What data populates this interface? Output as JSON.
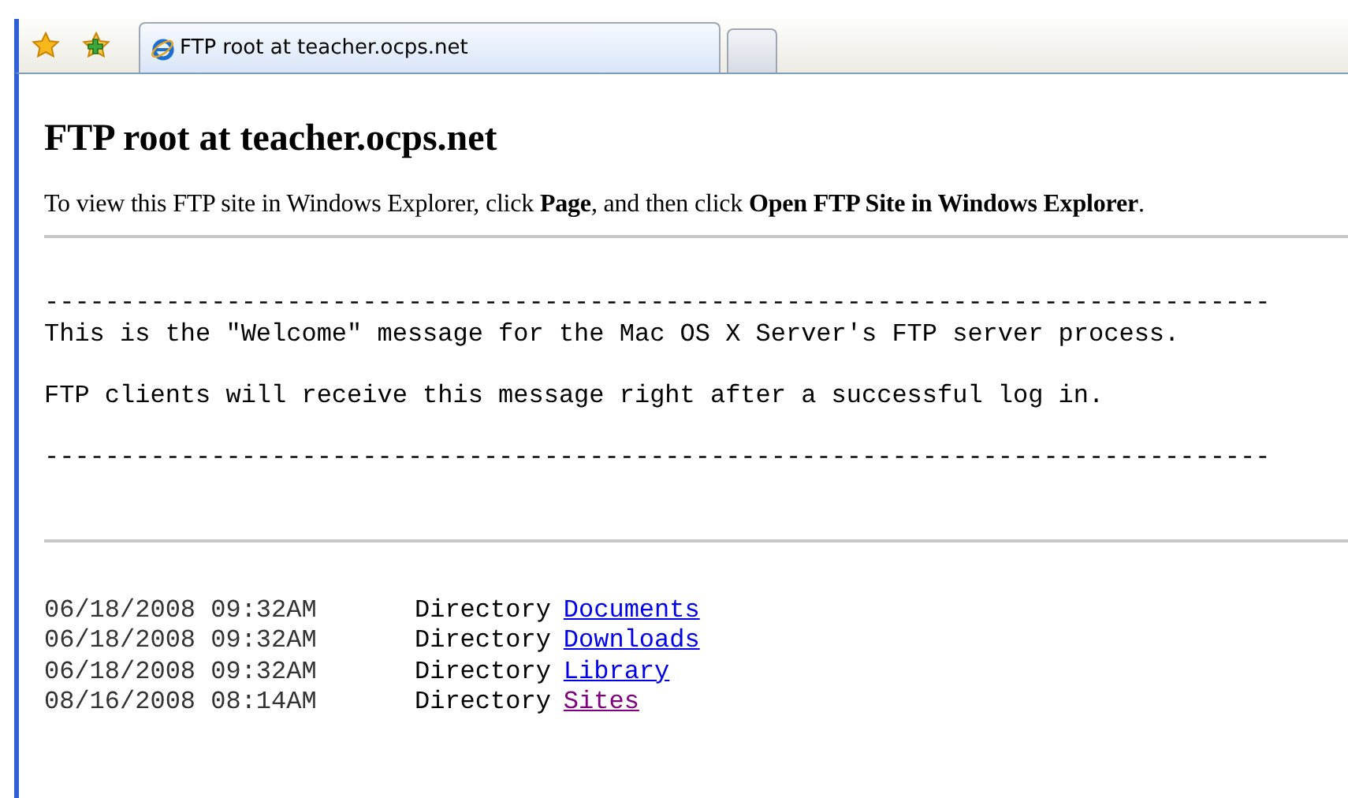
{
  "tab_bar": {
    "tabs": [
      {
        "title": "FTP root at teacher.ocps.net",
        "selected": true
      }
    ]
  },
  "page": {
    "heading": "FTP root at teacher.ocps.net",
    "instructions": "To view this FTP site in Windows Explorer, click **Page**, and then click **Open FTP Site in Windows Explorer**.",
    "welcome_message": [
      {
        "text": "---------------------------------------------------------------------------------",
        "blank_line_before": false
      },
      {
        "text": "This is the \"Welcome\" message for the Mac OS X Server's FTP server process.",
        "blank_line_before": false
      },
      {
        "text": "FTP clients will receive this message right after a successful log in.",
        "blank_line_before": true
      },
      {
        "text": "---------------------------------------------------------------------------------",
        "blank_line_before": true
      }
    ],
    "listing": [
      {
        "date": "06/18/2008 09:32AM",
        "type": "Directory",
        "name": "Documents",
        "visited": false
      },
      {
        "date": "06/18/2008 09:32AM",
        "type": "Directory",
        "name": "Downloads",
        "visited": false
      },
      {
        "date": "06/18/2008 09:32AM",
        "type": "Directory",
        "name": "Library",
        "visited": false
      },
      {
        "date": "08/16/2008 08:14AM",
        "type": "Directory",
        "name": "Sites",
        "visited": true
      }
    ]
  }
}
